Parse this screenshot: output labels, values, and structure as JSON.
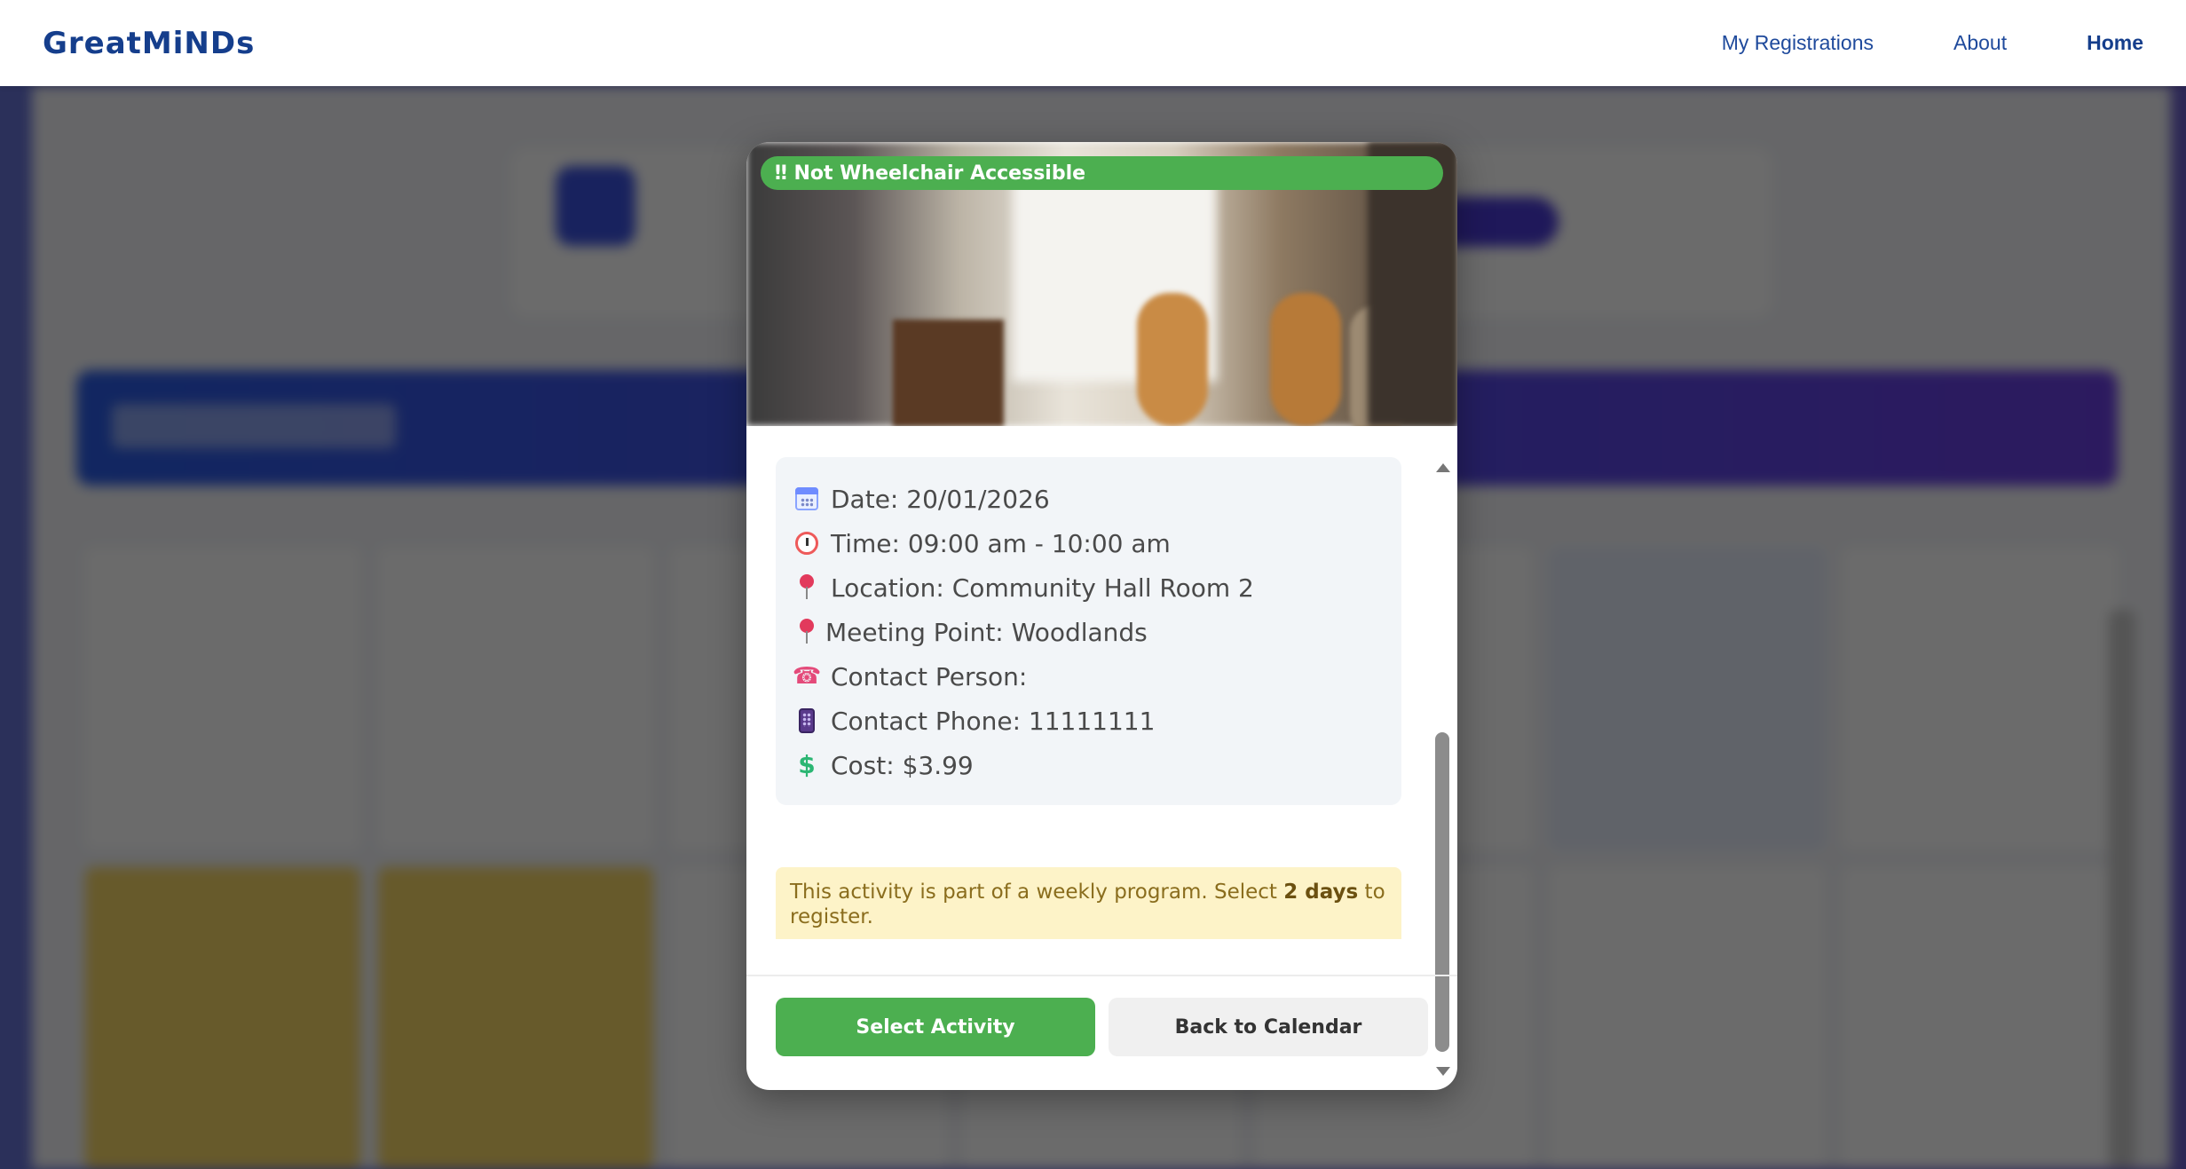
{
  "navbar": {
    "brand": "GreatMiNDs",
    "links": [
      {
        "label": "My Registrations"
      },
      {
        "label": "About"
      },
      {
        "label": "Home"
      }
    ]
  },
  "modal": {
    "accessibility_badge": "‼ Not Wheelchair Accessible",
    "image_alt": "Room with guitars",
    "details": {
      "date": "Date: 20/01/2026",
      "time": "Time: 09:00 am - 10:00 am",
      "location": "Location: Community Hall Room 2",
      "meeting_point": "Meeting Point: Woodlands",
      "contact_person": "Contact Person:",
      "contact_phone": "Contact Phone: 11111111",
      "cost": "Cost: $3.99"
    },
    "notice": {
      "prefix": "This activity is part of a weekly program. Select ",
      "highlight": "2 days",
      "suffix": " to register."
    },
    "buttons": {
      "select": "Select Activity",
      "back": "Back to Calendar"
    }
  },
  "colors": {
    "brand": "#153e8c",
    "accent_green": "#4caf50",
    "notice_bg": "#fdf3c8"
  },
  "icons": [
    "calendar-icon",
    "alarm-clock-icon",
    "pin-icon",
    "phone-icon",
    "mobile-phone-icon",
    "dollar-icon"
  ]
}
